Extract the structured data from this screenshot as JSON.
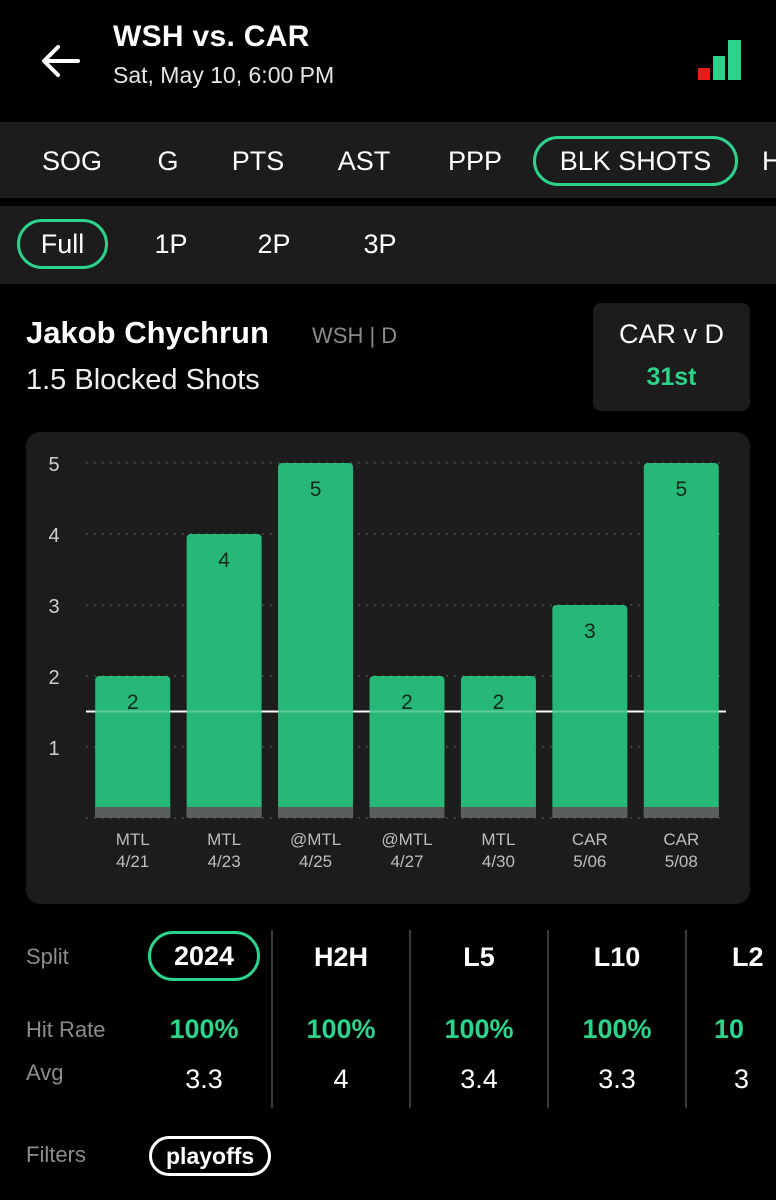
{
  "header": {
    "title": "WSH vs. CAR",
    "datetime": "Sat, May 10, 6:00 PM",
    "back_icon": "arrow-left-icon",
    "signal_icon": "bar-signal-icon",
    "signal_colors": [
      "#e81b1b",
      "#2ed38b"
    ]
  },
  "stat_tabs": [
    {
      "label": "SOG",
      "active": false
    },
    {
      "label": "G",
      "active": false
    },
    {
      "label": "PTS",
      "active": false
    },
    {
      "label": "AST",
      "active": false
    },
    {
      "label": "PPP",
      "active": false
    },
    {
      "label": "BLK SHOTS",
      "active": true
    },
    {
      "label": "H",
      "active": false
    }
  ],
  "period_tabs": [
    {
      "label": "Full",
      "active": true
    },
    {
      "label": "1P",
      "active": false
    },
    {
      "label": "2P",
      "active": false
    },
    {
      "label": "3P",
      "active": false
    }
  ],
  "player": {
    "name": "Jakob Chychrun",
    "meta": "WSH | D",
    "prop": "1.5 Blocked Shots"
  },
  "matchup": {
    "label": "CAR v D",
    "rank": "31st"
  },
  "chart_data": {
    "type": "bar",
    "categories": [
      "MTL\n4/21",
      "MTL\n4/23",
      "@MTL\n4/25",
      "@MTL\n4/27",
      "MTL\n4/30",
      "CAR\n5/06",
      "CAR\n5/08"
    ],
    "opponents": [
      "MTL",
      "MTL",
      "@MTL",
      "@MTL",
      "MTL",
      "CAR",
      "CAR"
    ],
    "dates": [
      "4/21",
      "4/23",
      "4/25",
      "4/27",
      "4/30",
      "5/06",
      "5/08"
    ],
    "values": [
      2,
      4,
      5,
      2,
      2,
      3,
      5
    ],
    "ylim": [
      0,
      5
    ],
    "yticks": [
      1,
      2,
      3,
      4,
      5
    ],
    "line": 1.5,
    "bar_color": "#27b877",
    "base_color": "#5a5e5c",
    "grid": true
  },
  "splits": {
    "split_label": "Split",
    "hit_label": "Hit Rate",
    "avg_label": "Avg",
    "columns": [
      {
        "name": "2024",
        "hit": "100%",
        "avg": "3.3",
        "active": true
      },
      {
        "name": "H2H",
        "hit": "100%",
        "avg": "4",
        "active": false
      },
      {
        "name": "L5",
        "hit": "100%",
        "avg": "3.4",
        "active": false
      },
      {
        "name": "L10",
        "hit": "100%",
        "avg": "3.3",
        "active": false
      },
      {
        "name": "L2",
        "hit": "10",
        "avg": "3",
        "active": false
      }
    ]
  },
  "filters": {
    "label": "Filters",
    "chips": [
      "playoffs"
    ]
  }
}
